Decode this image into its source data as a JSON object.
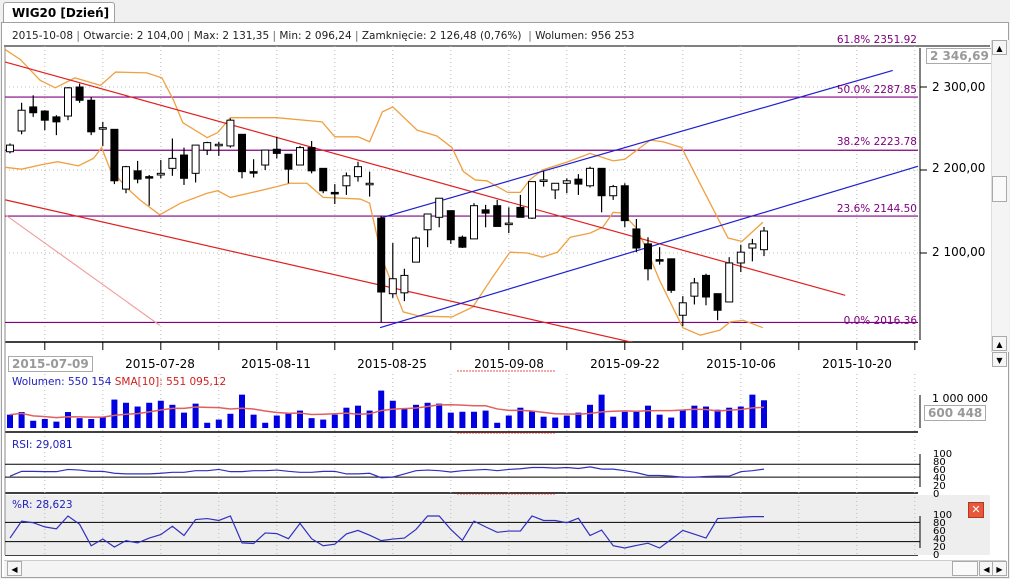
{
  "tab": {
    "title": "WIG20 [Dzień]"
  },
  "header": {
    "date": "2015-10-08",
    "open": "Otwarcie: 2 104,00",
    "max": "Max: 2 131,35",
    "min": "Min: 2 096,24",
    "close": "Zamknięcie: 2 126,48 (0,76%)",
    "volume": "Wolumen: 956 253"
  },
  "price_axis": {
    "highlight": "2 346,69",
    "labels": [
      "2 300,00",
      "2 200,00",
      "2 100,00"
    ],
    "values": [
      2300,
      2200,
      2100
    ]
  },
  "date_axis": {
    "highlight": "2015-07-09",
    "labels": [
      "2015-07-28",
      "2015-08-11",
      "2015-08-25",
      "2015-09-08",
      "2015-09-22",
      "2015-10-06",
      "2015-10-20"
    ],
    "indices": [
      13,
      23,
      33,
      43,
      53,
      63,
      73
    ]
  },
  "volume_panel": {
    "label": "Wolumen: 550 154",
    "sma_label": "SMA[10]: 551 095,12",
    "axis_top": "1 000 000",
    "highlight": "600 448"
  },
  "rsi_panel": {
    "label": "RSI: 29,081",
    "axis": [
      "100",
      "80",
      "60",
      "40",
      "20",
      "0"
    ]
  },
  "wr_panel": {
    "label": "%R: 28,623",
    "axis": [
      "100",
      "80",
      "60",
      "40",
      "20",
      "0"
    ]
  },
  "colors": {
    "fib": "#800080",
    "band": "#f0a040",
    "trend_red": "#e02020",
    "trend_blue": "#2020d0",
    "volume": "#0000e0",
    "sma": "#e06060",
    "indicator": "#3030c0"
  },
  "chart_data": {
    "type": "candlestick",
    "title": "WIG20 [Dzień]",
    "ylim": [
      1990,
      2360
    ],
    "candles_ohlc": [
      [
        2222,
        2232,
        2220,
        2230
      ],
      [
        2247,
        2281,
        2243,
        2272
      ],
      [
        2276,
        2290,
        2264,
        2269
      ],
      [
        2271,
        2272,
        2248,
        2260
      ],
      [
        2264,
        2266,
        2242,
        2258
      ],
      [
        2265,
        2300,
        2260,
        2299
      ],
      [
        2300,
        2304,
        2281,
        2284
      ],
      [
        2284,
        2288,
        2242,
        2246
      ],
      [
        2250,
        2258,
        2229,
        2251
      ],
      [
        2249,
        2249,
        2183,
        2187
      ],
      [
        2177,
        2205,
        2172,
        2204
      ],
      [
        2199,
        2211,
        2184,
        2189
      ],
      [
        2192,
        2194,
        2157,
        2191
      ],
      [
        2194,
        2212,
        2190,
        2196
      ],
      [
        2202,
        2238,
        2193,
        2214
      ],
      [
        2218,
        2227,
        2182,
        2190
      ],
      [
        2196,
        2230,
        2185,
        2230
      ],
      [
        2224,
        2234,
        2218,
        2233
      ],
      [
        2230,
        2234,
        2217,
        2231
      ],
      [
        2229,
        2262,
        2227,
        2260
      ],
      [
        2243,
        2243,
        2190,
        2198
      ],
      [
        2198,
        2213,
        2191,
        2197
      ],
      [
        2206,
        2224,
        2200,
        2224
      ],
      [
        2225,
        2240,
        2214,
        2220
      ],
      [
        2219,
        2219,
        2184,
        2201
      ],
      [
        2206,
        2229,
        2206,
        2227
      ],
      [
        2227,
        2235,
        2196,
        2199
      ],
      [
        2202,
        2202,
        2172,
        2175
      ],
      [
        2173,
        2183,
        2159,
        2172
      ],
      [
        2181,
        2197,
        2170,
        2193
      ],
      [
        2192,
        2210,
        2186,
        2204
      ],
      [
        2183,
        2198,
        2168,
        2184
      ],
      [
        2142,
        2145,
        2016.36,
        2053
      ],
      [
        2051,
        2112,
        2046,
        2069
      ],
      [
        2052,
        2081,
        2042,
        2073
      ],
      [
        2089,
        2120,
        2089,
        2118
      ],
      [
        2128,
        2147,
        2107,
        2147
      ],
      [
        2143,
        2166,
        2131,
        2166
      ],
      [
        2151,
        2151,
        2111,
        2116
      ],
      [
        2119,
        2121,
        2106,
        2107
      ],
      [
        2117,
        2160,
        2117,
        2157
      ],
      [
        2152,
        2158,
        2131,
        2148
      ],
      [
        2157,
        2164,
        2132,
        2132
      ],
      [
        2136,
        2155,
        2124,
        2136
      ],
      [
        2155,
        2170,
        2143,
        2143
      ],
      [
        2142,
        2186,
        2141,
        2186
      ],
      [
        2188,
        2199,
        2180,
        2188
      ],
      [
        2176,
        2184,
        2165,
        2184
      ],
      [
        2184,
        2190,
        2172,
        2187
      ],
      [
        2189,
        2195,
        2170,
        2183
      ],
      [
        2181,
        2204,
        2179,
        2202
      ],
      [
        2202,
        2202,
        2149,
        2169
      ],
      [
        2169,
        2182,
        2164,
        2180
      ],
      [
        2181,
        2184,
        2131,
        2139
      ],
      [
        2129,
        2141,
        2101,
        2106
      ],
      [
        2111,
        2119,
        2067,
        2081
      ],
      [
        2092,
        2107,
        2086,
        2091
      ],
      [
        2093,
        2093,
        2052,
        2055
      ],
      [
        2025,
        2048,
        2012,
        2040
      ],
      [
        2048,
        2070,
        2038,
        2064
      ],
      [
        2073,
        2075,
        2037,
        2047
      ],
      [
        2051,
        2051,
        2019,
        2031
      ],
      [
        2041,
        2095,
        2041,
        2088
      ],
      [
        2088,
        2110,
        2077,
        2101
      ],
      [
        2106,
        2117,
        2090,
        2111
      ],
      [
        2104,
        2131.35,
        2096.24,
        2126.48
      ]
    ],
    "fibonacci": [
      {
        "label": "61.8% 2351.92",
        "value": 2351.92
      },
      {
        "label": "50.0% 2287.85",
        "value": 2287.85
      },
      {
        "label": "38.2% 2223.78",
        "value": 2223.78
      },
      {
        "label": "23.6% 2144.50",
        "value": 2144.5
      },
      {
        "label": "0.0% 2016.36",
        "value": 2016.36
      }
    ],
    "bollinger_upper": [
      [
        -0.4,
        2345
      ],
      [
        0.9,
        2333
      ],
      [
        2.6,
        2308
      ],
      [
        3.9,
        2299
      ],
      [
        5.6,
        2311
      ],
      [
        7.8,
        2302
      ],
      [
        9.1,
        2318
      ],
      [
        11.8,
        2317
      ],
      [
        13.1,
        2311
      ],
      [
        14.1,
        2284
      ],
      [
        14.9,
        2257
      ],
      [
        17,
        2239
      ],
      [
        17.9,
        2245
      ],
      [
        19,
        2263
      ],
      [
        23,
        2263
      ],
      [
        26.9,
        2258
      ],
      [
        28,
        2240
      ],
      [
        30,
        2240
      ],
      [
        31,
        2234
      ],
      [
        32.1,
        2270
      ],
      [
        33,
        2276
      ],
      [
        35.1,
        2248
      ],
      [
        36.8,
        2241
      ],
      [
        38.1,
        2227
      ],
      [
        39.1,
        2198
      ],
      [
        40.1,
        2188
      ],
      [
        41.1,
        2187
      ],
      [
        42.9,
        2173
      ],
      [
        44,
        2173
      ],
      [
        44.8,
        2188
      ],
      [
        45.9,
        2200
      ],
      [
        48.1,
        2210
      ],
      [
        50,
        2220
      ],
      [
        52,
        2211
      ],
      [
        53,
        2213
      ],
      [
        55.2,
        2236
      ],
      [
        56.3,
        2234
      ],
      [
        57.9,
        2227
      ],
      [
        59.1,
        2194
      ],
      [
        60.1,
        2167
      ],
      [
        61.9,
        2118
      ],
      [
        63.1,
        2114
      ],
      [
        64.9,
        2137
      ]
    ],
    "bollinger_lower": [
      [
        -0.9,
        2204
      ],
      [
        1,
        2201
      ],
      [
        2.6,
        2206
      ],
      [
        4.1,
        2210
      ],
      [
        5.9,
        2205
      ],
      [
        7.2,
        2214
      ],
      [
        7.9,
        2227
      ],
      [
        8.6,
        2202
      ],
      [
        10.1,
        2178
      ],
      [
        11.2,
        2164
      ],
      [
        12.9,
        2146
      ],
      [
        14.7,
        2160
      ],
      [
        17,
        2172
      ],
      [
        17.9,
        2175
      ],
      [
        19,
        2167
      ],
      [
        20.9,
        2173
      ],
      [
        23,
        2180
      ],
      [
        24.1,
        2184
      ],
      [
        25.6,
        2184
      ],
      [
        27,
        2167
      ],
      [
        30.2,
        2165
      ],
      [
        31,
        2160
      ],
      [
        32.1,
        2092
      ],
      [
        33.9,
        2029
      ],
      [
        35.3,
        2024
      ],
      [
        38.1,
        2023
      ],
      [
        39.9,
        2035
      ],
      [
        41.6,
        2071
      ],
      [
        43.1,
        2101
      ],
      [
        44.6,
        2100
      ],
      [
        45.9,
        2095
      ],
      [
        47.2,
        2101
      ],
      [
        48.3,
        2119
      ],
      [
        50,
        2124
      ],
      [
        51.1,
        2131
      ],
      [
        52,
        2149
      ],
      [
        52.8,
        2148
      ],
      [
        54,
        2130
      ],
      [
        54.9,
        2104
      ],
      [
        56,
        2067
      ],
      [
        58,
        2010
      ],
      [
        59.5,
        2001
      ],
      [
        61.2,
        2007
      ],
      [
        62.1,
        2017
      ],
      [
        63.2,
        2019
      ],
      [
        64.9,
        2010
      ]
    ],
    "trendlines": [
      {
        "color": "red",
        "from": [
          -0.4,
          2330
        ],
        "to": [
          72,
          2049
        ]
      },
      {
        "color": "red",
        "from": [
          -0.4,
          2164
        ],
        "to": [
          54.7,
          1989
        ]
      },
      {
        "color": "pink",
        "from": [
          -0.4,
          2146
        ],
        "to": [
          12.9,
          2013
        ]
      },
      {
        "color": "blue",
        "from": [
          31.9,
          2142
        ],
        "to": [
          76.1,
          2320
        ]
      },
      {
        "color": "blue",
        "from": [
          31.9,
          2010
        ],
        "to": [
          78.4,
          2205
        ]
      }
    ],
    "volume": [
      460000,
      550000,
      250000,
      310000,
      220000,
      550000,
      340000,
      310000,
      380000,
      980000,
      870000,
      740000,
      870000,
      940000,
      800000,
      530000,
      840000,
      180000,
      290000,
      490000,
      1150000,
      460000,
      180000,
      430000,
      530000,
      600000,
      340000,
      290000,
      460000,
      700000,
      770000,
      600000,
      1290000,
      940000,
      690000,
      800000,
      870000,
      840000,
      530000,
      560000,
      560000,
      600000,
      180000,
      430000,
      700000,
      600000,
      390000,
      360000,
      430000,
      530000,
      800000,
      1150000,
      390000,
      560000,
      560000,
      770000,
      460000,
      360000,
      630000,
      770000,
      740000,
      630000,
      700000,
      740000,
      1150000,
      956253
    ],
    "volume_ylim": [
      0,
      1300000
    ],
    "rsi": [
      33,
      48,
      48,
      47,
      47,
      54,
      52,
      48,
      48,
      42,
      40,
      40,
      40,
      42,
      45,
      45,
      50,
      50,
      54,
      47,
      47,
      50,
      50,
      52,
      48,
      45,
      45,
      48,
      48,
      40,
      40,
      42,
      28,
      30,
      40,
      50,
      52,
      50,
      46,
      50,
      52,
      54,
      50,
      54,
      56,
      60,
      60,
      58,
      60,
      57,
      62,
      55,
      55,
      50,
      44,
      35,
      35,
      33,
      30,
      30,
      32,
      33,
      33,
      47,
      50,
      55
    ],
    "rsi_levels": [
      30,
      70
    ],
    "williams_r": [
      31,
      84,
      79,
      66,
      60,
      100,
      74,
      7,
      28,
      3,
      23,
      16,
      31,
      42,
      68,
      39,
      89,
      92,
      86,
      100,
      16,
      14,
      47,
      45,
      29,
      77,
      29,
      7,
      12,
      44,
      55,
      40,
      23,
      28,
      31,
      58,
      100,
      100,
      58,
      24,
      84,
      66,
      49,
      53,
      53,
      100,
      86,
      86,
      79,
      93,
      39,
      56,
      7,
      0,
      8,
      15,
      0,
      27,
      55,
      43,
      31,
      92,
      94,
      96,
      98,
      98
    ],
    "williams_levels": [
      20,
      80
    ]
  }
}
